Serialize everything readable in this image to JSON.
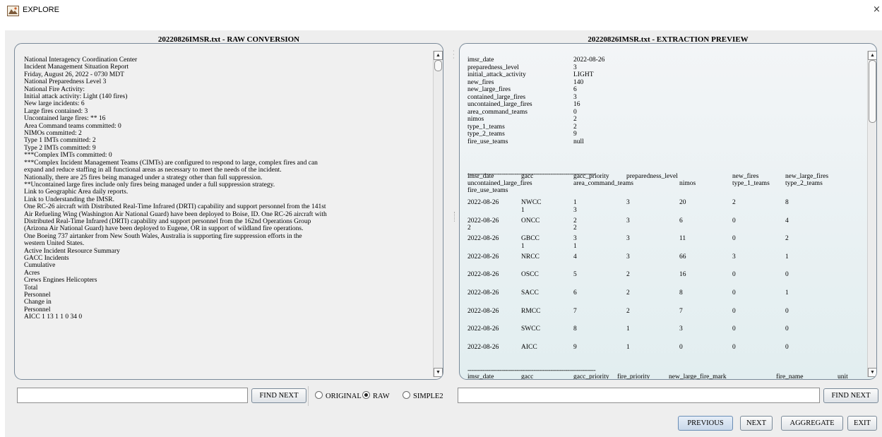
{
  "window": {
    "title": "EXPLORE",
    "app_icon": "explore-app-icon",
    "close_glyph": "×"
  },
  "left_panel": {
    "title": "20220826IMSR.txt - RAW CONVERSION",
    "lines": [
      "National Interagency Coordination Center",
      "Incident Management Situation Report",
      "Friday, August 26, 2022 - 0730 MDT",
      "National Preparedness Level 3",
      "National Fire Activity:",
      "Initial attack activity: Light (140 fires)",
      "New large incidents: 6",
      "Large fires contained: 3",
      "Uncontained large fires: ** 16",
      "Area Command teams committed: 0",
      "NIMOs committed: 2",
      "Type 1 IMTs committed: 2",
      "Type 2 IMTs committed: 9",
      "***Complex IMTs committed: 0",
      "***Complex Incident Management Teams (CIMTs) are configured to respond to large, complex fires and can",
      "expand and reduce staffing in all functional areas as necessary to meet the needs of the incident.",
      "Nationally, there are 25 fires being managed under a strategy other than full suppression.",
      "**Uncontained large fires include only fires being managed under a full suppression strategy.",
      "Link to Geographic Area daily reports.",
      "Link to Understanding the IMSR.",
      "One RC-26 aircraft with Distributed Real-Time Infrared (DRTI) capability and support personnel from the 141st",
      "Air Refueling Wing (Washington Air National Guard) have been deployed to Boise, ID. One RC-26 aircraft with",
      "Distributed Real-Time Infrared (DRTI) capability and support personnel from the 162nd Operations Group",
      "(Arizona Air National Guard) have been deployed to Eugene, OR in support of wildland fire operations.",
      "One Boeing 737 airtanker from New South Wales, Australia is supporting fire suppression efforts in the",
      "western United States.",
      "Active Incident Resource Summary",
      "GACC Incidents",
      "Cumulative",
      "Acres",
      "Crews Engines Helicopters",
      "Total",
      "Personnel",
      "Change in",
      "Personnel",
      "AICC 1 13 1 1 0 34 0"
    ],
    "find_label": "FIND NEXT",
    "find_value": "",
    "radio_options": [
      {
        "label": "ORIGINAL",
        "checked": false
      },
      {
        "label": "RAW",
        "checked": true
      },
      {
        "label": "SIMPLE2",
        "checked": false
      }
    ]
  },
  "right_panel": {
    "title": "20220826IMSR.txt - EXTRACTION PREVIEW",
    "summary": [
      {
        "key": "imsr_date",
        "value": "2022-08-26"
      },
      {
        "key": "preparedness_level",
        "value": "3"
      },
      {
        "key": "initial_attack_activity",
        "value": "LIGHT"
      },
      {
        "key": "new_fires",
        "value": "140"
      },
      {
        "key": "new_large_fires",
        "value": "6"
      },
      {
        "key": "contained_large_fires",
        "value": "3"
      },
      {
        "key": "uncontained_large_fires",
        "value": "16"
      },
      {
        "key": "area_command_teams",
        "value": "0"
      },
      {
        "key": "nimos",
        "value": "2"
      },
      {
        "key": "type_1_teams",
        "value": "2"
      },
      {
        "key": "type_2_teams",
        "value": "9"
      },
      {
        "key": "fire_use_teams",
        "value": "null"
      }
    ],
    "separator": "--------------------------------------------------------------------",
    "gacc_headers": [
      "imsr_date",
      "gacc",
      "gacc_priority",
      "preparedness_level",
      "new_fires",
      "new_large_fires",
      "uncontained_large_fires",
      "area_command_teams",
      "nimos",
      "type_1_teams",
      "type_2_teams",
      "fire_use_teams"
    ],
    "gacc_rows": [
      {
        "date": "2022-08-26",
        "gacc": "NWCC",
        "priority": "1",
        "pl": "3",
        "new_fires": "20",
        "nlf": "2",
        "ulf": "8",
        "sub1": "1",
        "sub2": "3"
      },
      {
        "date": "2022-08-26",
        "gacc": "ONCC",
        "priority": "2",
        "pl": "3",
        "new_fires": "6",
        "nlf": "0",
        "ulf": "4",
        "sub0": "2",
        "sub2": "2"
      },
      {
        "date": "2022-08-26",
        "gacc": "GBCC",
        "priority": "3",
        "pl": "3",
        "new_fires": "11",
        "nlf": "0",
        "ulf": "2",
        "sub1": "1",
        "sub2": "1"
      },
      {
        "date": "2022-08-26",
        "gacc": "NRCC",
        "priority": "4",
        "pl": "3",
        "new_fires": "66",
        "nlf": "3",
        "ulf": "1"
      },
      {
        "date": "2022-08-26",
        "gacc": "OSCC",
        "priority": "5",
        "pl": "2",
        "new_fires": "16",
        "nlf": "0",
        "ulf": "0"
      },
      {
        "date": "2022-08-26",
        "gacc": "SACC",
        "priority": "6",
        "pl": "2",
        "new_fires": "8",
        "nlf": "0",
        "ulf": "1"
      },
      {
        "date": "2022-08-26",
        "gacc": "RMCC",
        "priority": "7",
        "pl": "2",
        "new_fires": "7",
        "nlf": "0",
        "ulf": "0"
      },
      {
        "date": "2022-08-26",
        "gacc": "SWCC",
        "priority": "8",
        "pl": "1",
        "new_fires": "3",
        "nlf": "0",
        "ulf": "0"
      },
      {
        "date": "2022-08-26",
        "gacc": "AICC",
        "priority": "9",
        "pl": "1",
        "new_fires": "0",
        "nlf": "0",
        "ulf": "0"
      }
    ],
    "fire_headers": [
      "imsr_date",
      "gacc",
      "gacc_priority",
      "fire_priority",
      "new_large_fire_mark",
      "fire_name",
      "unit"
    ],
    "find_label": "FIND NEXT",
    "find_value": ""
  },
  "footer_buttons": {
    "previous": "PREVIOUS",
    "next": "NEXT",
    "aggregate": "AGGREGATE",
    "exit": "EXIT"
  }
}
